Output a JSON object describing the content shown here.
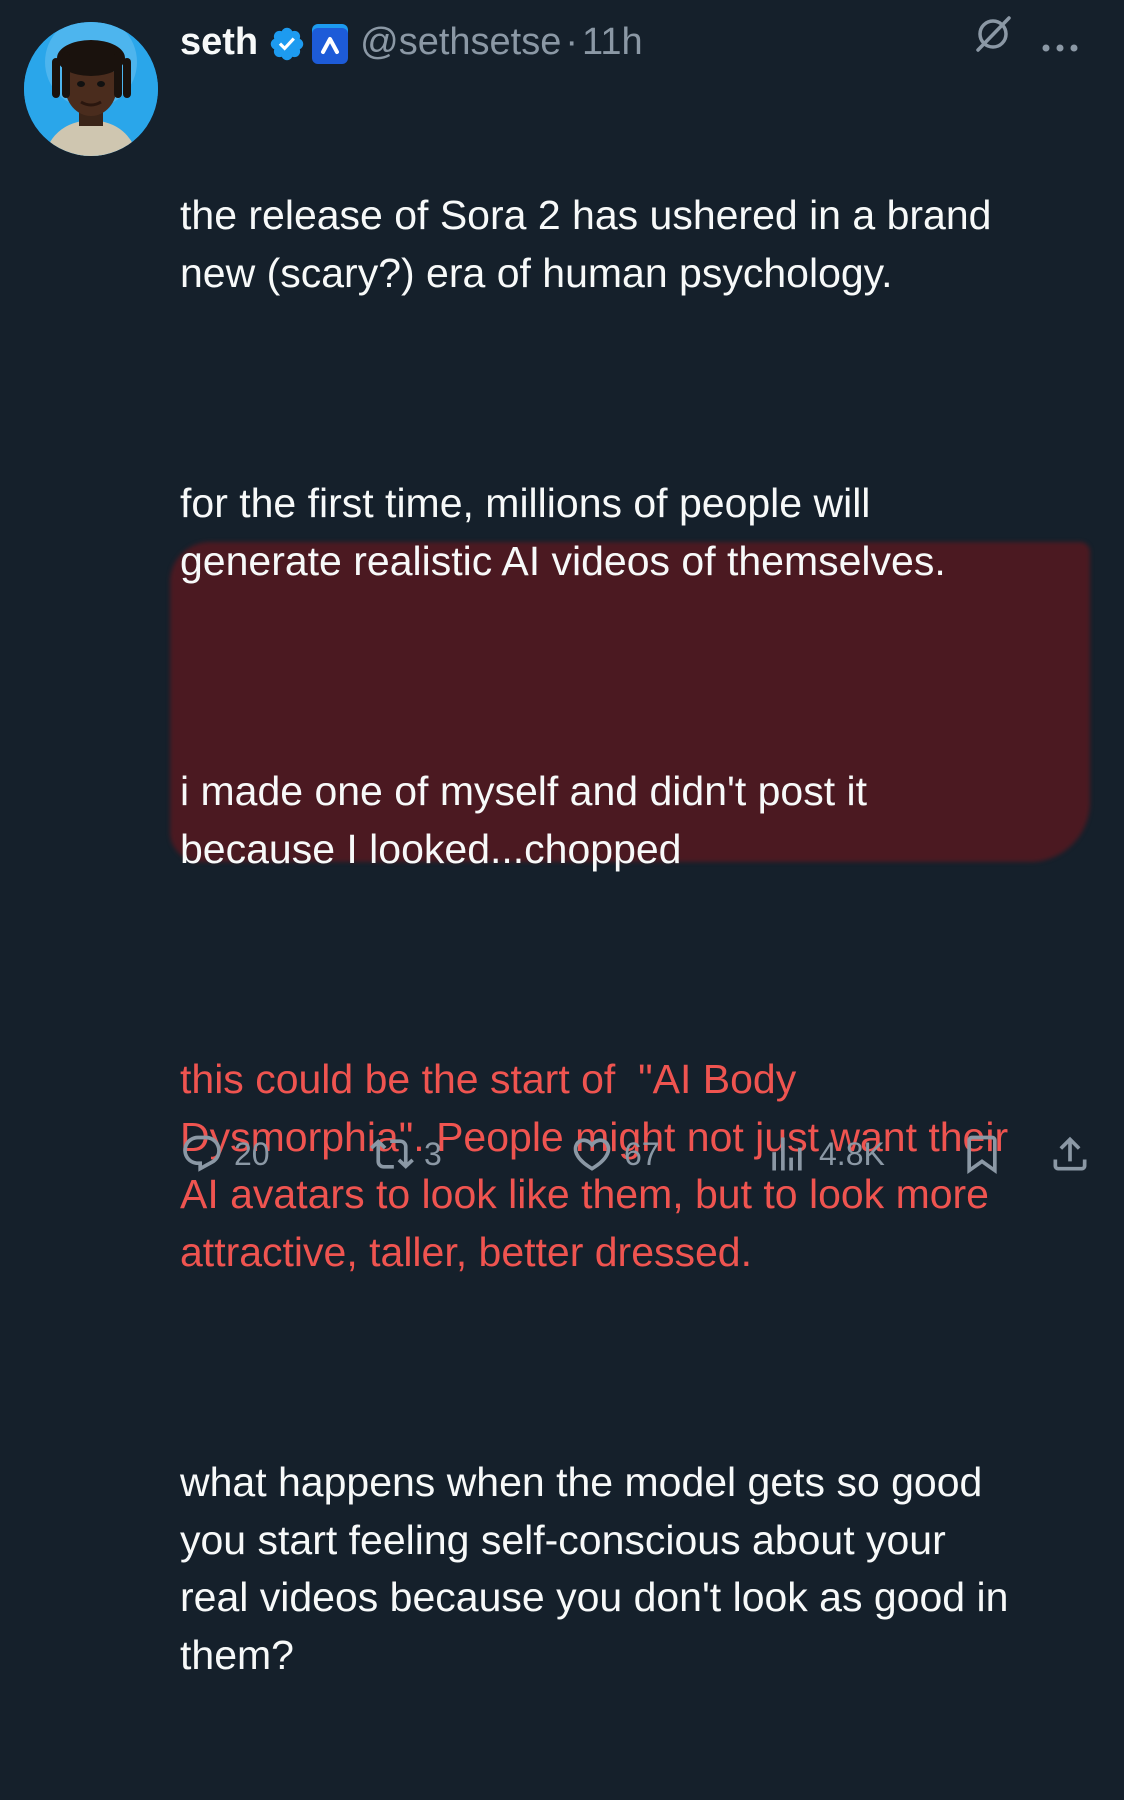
{
  "author": {
    "display_name": "seth",
    "handle": "@sethsetse",
    "separator": "·",
    "time": "11h",
    "verified_badge_icon": "verified-badge-icon",
    "affiliation_icon": "affiliation-badge-icon"
  },
  "header_actions": {
    "grok_icon": "grok-icon",
    "more_icon": "more-icon"
  },
  "tweet": {
    "p1": "the release of Sora 2 has ushered in a brand\nnew (scary?) era of human psychology.",
    "p2": "for the first time, millions of people will\ngenerate realistic AI videos of themselves.",
    "p3": "i made one of myself and didn't post it\nbecause I looked...chopped",
    "p4": "this could be the start of  \"AI Body\nDysmorphia\". People might not just want their\nAI avatars to look like them, but to look more\nattractive, taller, better dressed.",
    "p5": "what happens when the model gets so good\nyou start feeling self-conscious about your\nreal videos because you don't look as good in\nthem?"
  },
  "actions": {
    "reply_count": "20",
    "repost_count": "3",
    "like_count": "67",
    "views_count": "4.8K"
  },
  "colors": {
    "background": "#15202b",
    "text": "#f7f9f9",
    "secondary": "#8b98a5",
    "accent": "#1d9bf0",
    "highlight_text": "#ef5450"
  }
}
